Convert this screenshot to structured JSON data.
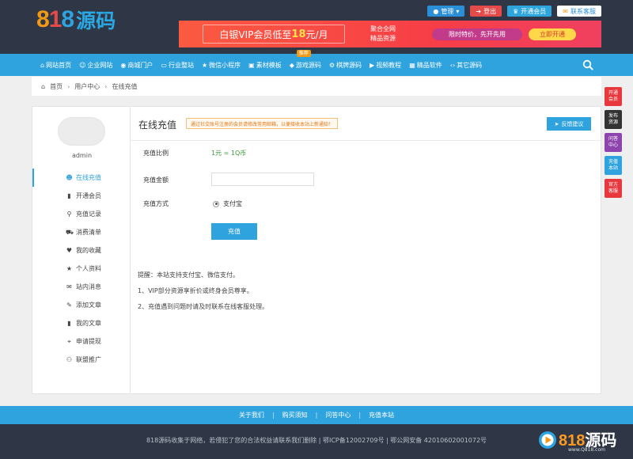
{
  "brand": {
    "logo_digits": "818",
    "logo_text": "源码",
    "colors": {
      "d1": "#f29a16",
      "d2": "#e34a4a",
      "d3": "#2fa3de"
    }
  },
  "top_buttons": [
    {
      "label": "管理",
      "icon": "user-icon"
    },
    {
      "label": "登出",
      "icon": "logout-icon"
    },
    {
      "label": "开通会员",
      "icon": "vip-icon"
    },
    {
      "label": "联系客服",
      "icon": "chat-icon"
    }
  ],
  "banner": {
    "main_prefix": "白银VIP会员低至",
    "main_num": "18",
    "main_suffix": "元/月",
    "side_line1": "聚合全网",
    "side_line2": "精品资源",
    "pill": "限时特价，先开先用",
    "cta": "立即开通"
  },
  "nav": {
    "items": [
      {
        "label": "网站首页",
        "icon": "home-icon"
      },
      {
        "label": "企业网站",
        "icon": "users-icon"
      },
      {
        "label": "商城门户",
        "icon": "github-icon"
      },
      {
        "label": "行业整站",
        "icon": "card-icon"
      },
      {
        "label": "微信小程序",
        "icon": "star-icon"
      },
      {
        "label": "素材模板",
        "icon": "sticker-icon"
      },
      {
        "label": "游戏源码",
        "icon": "gem-icon",
        "badge": "推荐"
      },
      {
        "label": "棋牌源码",
        "icon": "settings-icon"
      },
      {
        "label": "视频教程",
        "icon": "video-icon"
      },
      {
        "label": "精品软件",
        "icon": "apps-icon"
      },
      {
        "label": "其它源码",
        "icon": "code-icon"
      }
    ]
  },
  "breadcrumb": {
    "home": "首页",
    "parent": "用户中心",
    "current": "在线充值"
  },
  "sidebar": {
    "username": "admin",
    "items": [
      {
        "label": "在线充值",
        "icon": "person-icon",
        "active": true
      },
      {
        "label": "开通会员",
        "icon": "book-icon"
      },
      {
        "label": "充值记录",
        "icon": "search-icon"
      },
      {
        "label": "消费清单",
        "icon": "cart-icon"
      },
      {
        "label": "我的收藏",
        "icon": "heart-icon"
      },
      {
        "label": "个人资料",
        "icon": "star-icon"
      },
      {
        "label": "站内消息",
        "icon": "message-icon"
      },
      {
        "label": "添加文章",
        "icon": "edit-icon"
      },
      {
        "label": "我的文章",
        "icon": "book-icon"
      },
      {
        "label": "申请提现",
        "icon": "money-icon"
      },
      {
        "label": "联盟推广",
        "icon": "group-icon"
      }
    ]
  },
  "main": {
    "title": "在线充值",
    "notice": "通过社交账号注册的会员请修改常用邮箱，以便接收本站上新通知！",
    "feedback": "反馈建议",
    "ratio_label": "充值比例",
    "ratio_value": "1元 = 1Q币",
    "amount_label": "充值金额",
    "method_label": "充值方式",
    "method_value": "支付宝",
    "submit": "充值",
    "tips": [
      "提醒：本站支持支付宝、微信支付。",
      "1、VIP部分资源享折价或终身会员尊享。",
      "2、充值遇到问题时请及时联系在线客服处理。"
    ]
  },
  "float_tabs": [
    {
      "l1": "开通",
      "l2": "会员",
      "color": "#e8383d"
    },
    {
      "l1": "发布",
      "l2": "资源",
      "color": "#333333"
    },
    {
      "l1": "问答",
      "l2": "中心",
      "color": "#8e44ad"
    },
    {
      "l1": "充值",
      "l2": "本站",
      "color": "#2fa3de"
    },
    {
      "l1": "官方",
      "l2": "客服",
      "color": "#e8383d"
    }
  ],
  "footer": {
    "links": [
      "关于我们",
      "购买须知",
      "问答中心",
      "充值本站"
    ],
    "copyright": "818源码收集于网络，若侵犯了您的合法权益请联系我们删除 | 鄂ICP备12002709号 | 鄂公网安备 42010602001072号"
  },
  "watermark": {
    "digits": "818",
    "text": "源码",
    "url": "www.Q818.com"
  }
}
